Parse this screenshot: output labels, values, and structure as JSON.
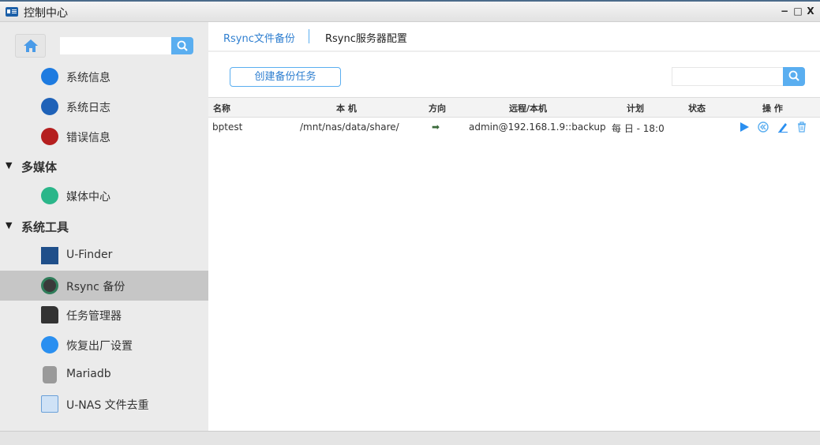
{
  "window": {
    "title": "控制中心",
    "minimize": "−",
    "maximize": "□",
    "close": "X"
  },
  "sidebar": {
    "search_placeholder": "",
    "items": [
      {
        "label": "系统信息",
        "icon": "system-info-icon",
        "color": "#1e7be0"
      },
      {
        "label": "系统日志",
        "icon": "system-log-icon",
        "color": "#1f62b8"
      },
      {
        "label": "错误信息",
        "icon": "error-info-icon",
        "color": "#b51f1f"
      },
      {
        "label": "媒体中心",
        "icon": "media-center-icon",
        "color": "#2bb68a"
      },
      {
        "label": "U-Finder",
        "icon": "u-finder-icon",
        "color": "#1f4f8a"
      },
      {
        "label": "Rsync 备份",
        "icon": "rsync-icon",
        "color": "#3a3a3a"
      },
      {
        "label": "任务管理器",
        "icon": "task-manager-icon",
        "color": "#333333"
      },
      {
        "label": "恢复出厂设置",
        "icon": "factory-reset-icon",
        "color": "#2a8ff0"
      },
      {
        "label": "Mariadb",
        "icon": "mariadb-icon",
        "color": "#9a9a9a"
      },
      {
        "label": "U-NAS 文件去重",
        "icon": "dedup-icon",
        "color": "#6aa0d8"
      }
    ],
    "sections": [
      {
        "label": "多媒体"
      },
      {
        "label": "系统工具"
      }
    ],
    "selected": "Rsync 备份"
  },
  "tabs": [
    {
      "label": "Rsync文件备份",
      "active": true
    },
    {
      "label": "Rsync服务器配置",
      "active": false
    }
  ],
  "toolbar": {
    "create_label": "创建备份任务",
    "search_placeholder": ""
  },
  "table": {
    "headers": [
      "名称",
      "本 机",
      "方向",
      "远程/本机",
      "计划",
      "状态",
      "操 作"
    ],
    "rows": [
      {
        "name": "bptest",
        "local": "/mnt/nas/data/share/",
        "direction": "➡",
        "remote": "admin@192.168.1.9::backup",
        "schedule": "每 日 - 18:0",
        "status": ""
      }
    ]
  },
  "colors": {
    "accent": "#5aaef0",
    "selected": "#c6c6c6"
  }
}
